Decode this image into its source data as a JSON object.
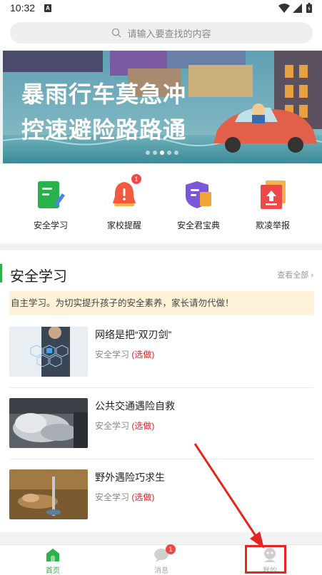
{
  "status_bar": {
    "time": "10:32",
    "indicator": "A"
  },
  "search": {
    "placeholder": "请输入要查找的内容"
  },
  "banner": {
    "line1": "暴雨行车莫急冲",
    "line2": "控速避险路路通",
    "dots": 5,
    "active_dot": 2
  },
  "quick_actions": [
    {
      "label": "安全学习",
      "icon": "study-book-icon",
      "color": "#27b24a"
    },
    {
      "label": "家校提醒",
      "icon": "bell-icon",
      "color": "#f25a40",
      "badge": "1"
    },
    {
      "label": "安全君宝典",
      "icon": "shield-book-icon",
      "color": "#7b56d6"
    },
    {
      "label": "欺凌举报",
      "icon": "report-upload-icon",
      "color": "#f04848"
    }
  ],
  "section": {
    "title": "安全学习",
    "more": "查看全部 ›",
    "notice": "自主学习。为切实提升孩子的安全素养，家长请勿代做！",
    "courses": [
      {
        "title": "网络是把“双刃剑”",
        "category": "安全学习",
        "tag": "(选做)"
      },
      {
        "title": "公共交通遇险自救",
        "category": "安全学习",
        "tag": "(选做)"
      },
      {
        "title": "野外遇险巧求生",
        "category": "安全学习",
        "tag": "(选做)"
      }
    ]
  },
  "tabs": [
    {
      "label": "首页",
      "icon": "home-icon",
      "active": true
    },
    {
      "label": "消息",
      "icon": "message-icon",
      "badge": "1"
    },
    {
      "label": "我的",
      "icon": "profile-icon"
    }
  ],
  "colors": {
    "accent": "#2cb24a",
    "badge": "#f04848",
    "annotation": "#e3261f",
    "notice_bg": "#fdf1d7"
  }
}
